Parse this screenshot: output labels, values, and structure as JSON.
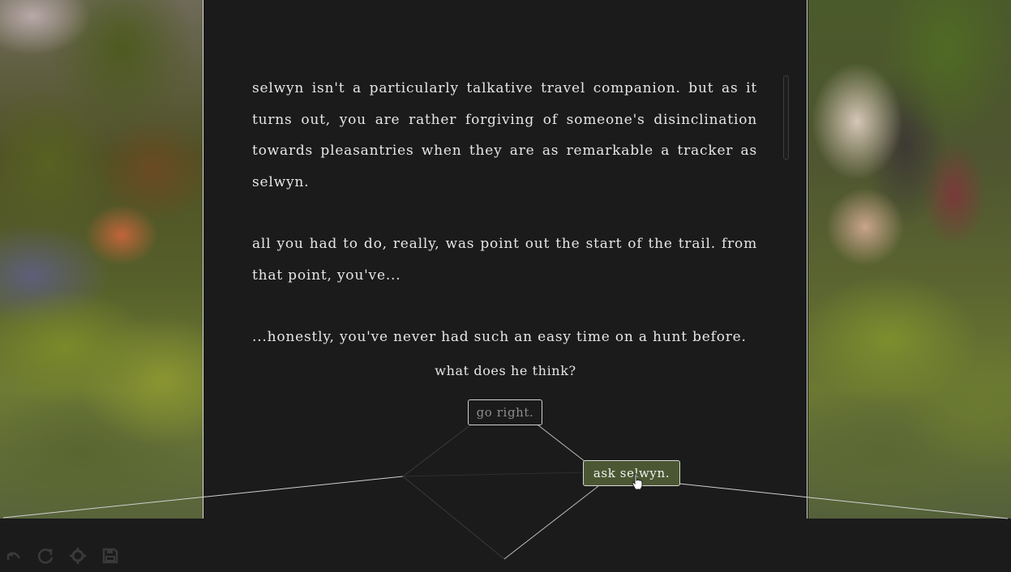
{
  "story": {
    "paragraphs": [
      "selwyn isn't a particularly talkative travel companion. but as it turns out, you are rather forgiving of someone's disinclination towards pleasantries when they are as remarkable a tracker as selwyn.",
      "all you had to do, really, was point out the start of the trail. from that point, you've...",
      "...honestly, you've never had such an easy time on a hunt before."
    ]
  },
  "prompt": {
    "question": "what does he think?"
  },
  "choices": {
    "go_right": "go right.",
    "ask_selwyn": "ask selwyn."
  },
  "toolbar": {
    "icons": [
      "undo-icon",
      "redo-icon",
      "settings-icon",
      "save-icon"
    ]
  },
  "colors": {
    "background": "#1b1b1b",
    "text": "#e6e6e6",
    "choice_highlight": "#4b5733",
    "choice_dim_text": "#8d8d8d",
    "panel_border": "#d8d8d8",
    "toolbar_icon": "#3a3a3a"
  }
}
